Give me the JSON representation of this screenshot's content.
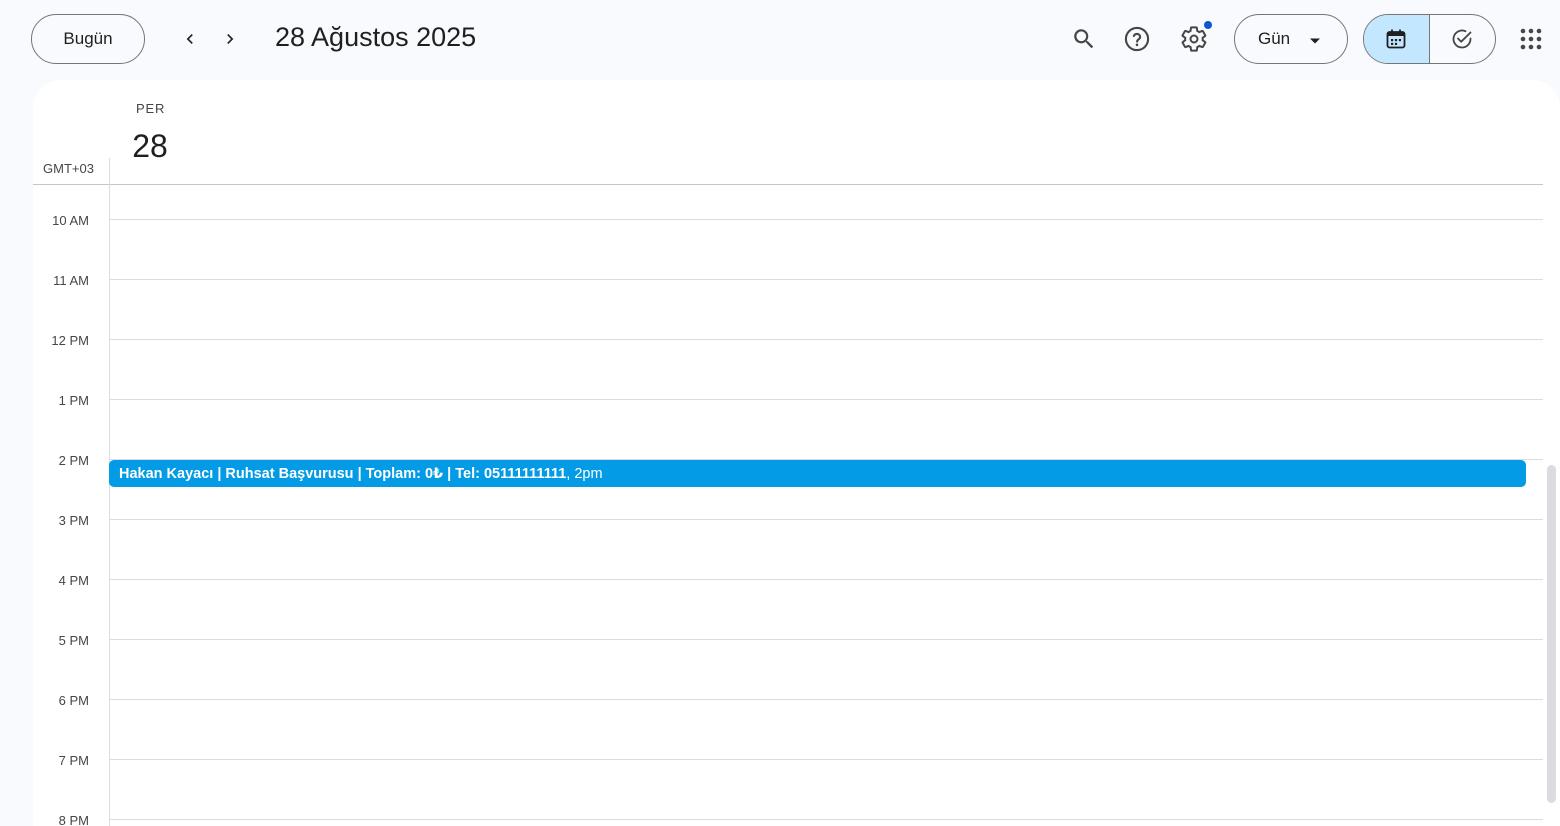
{
  "header": {
    "today_label": "Bugün",
    "date_title": "28 Ağustos 2025",
    "view_label": "Gün"
  },
  "day_column": {
    "weekday": "PER",
    "day_number": "28",
    "timezone": "GMT+03"
  },
  "hours": [
    "10 AM",
    "11 AM",
    "12 PM",
    "1 PM",
    "2 PM",
    "3 PM",
    "4 PM",
    "5 PM",
    "6 PM",
    "7 PM",
    "8 PM"
  ],
  "event": {
    "title": "Hakan Kayacı | Ruhsat Başvurusu | Toplam: 0₺ | Tel: 05111111111",
    "time": ", 2pm",
    "color": "#039be5"
  },
  "icons": {
    "search": "search-icon",
    "help": "help-icon",
    "settings": "gear-icon",
    "calendar": "calendar-icon",
    "tasks": "task-check-icon",
    "apps": "apps-grid-icon"
  },
  "colors": {
    "accent_active": "#c2e7ff",
    "notification_dot": "#0b57d0"
  }
}
